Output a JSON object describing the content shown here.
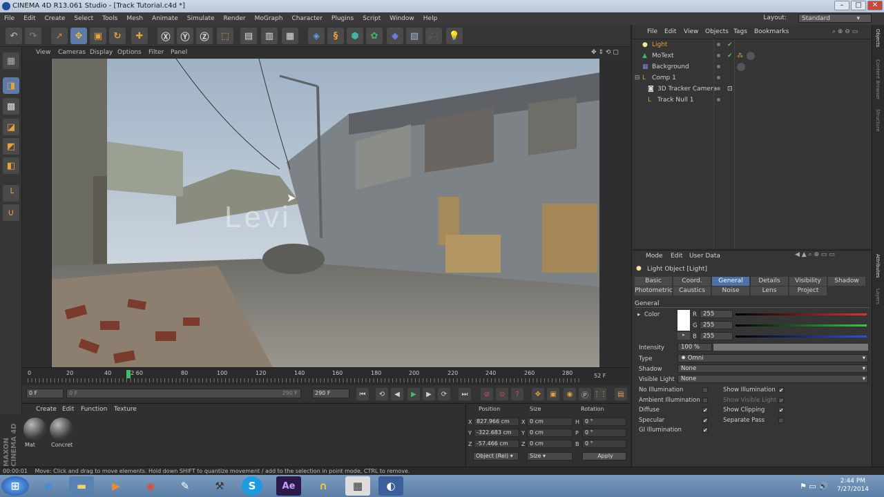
{
  "window": {
    "title": "CINEMA 4D R13.061 Studio - [Track Tutorial.c4d *]"
  },
  "menubar": {
    "items": [
      "File",
      "Edit",
      "Create",
      "Select",
      "Tools",
      "Mesh",
      "Animate",
      "Simulate",
      "Render",
      "MoGraph",
      "Character",
      "Plugins",
      "Script",
      "Window",
      "Help"
    ],
    "layout_label": "Layout:",
    "layout_value": "Standard"
  },
  "viewport": {
    "menu": [
      "View",
      "Cameras",
      "Display",
      "Options",
      "Filter",
      "Panel"
    ],
    "overlay_text": "Levi"
  },
  "timeline": {
    "ticks": [
      "0",
      "20",
      "40",
      "52 60",
      "80",
      "100",
      "120",
      "140",
      "160",
      "180",
      "200",
      "220",
      "240",
      "260",
      "280"
    ],
    "end_label": "52 F",
    "current_frame": 52,
    "max_frame": 290
  },
  "animbar": {
    "start": "0 F",
    "slider_start": "0 F",
    "slider_end": "290 F",
    "end": "290 F"
  },
  "materials": {
    "menu": [
      "Create",
      "Edit",
      "Function",
      "Texture"
    ],
    "items": [
      "Mat",
      "Concret"
    ]
  },
  "coords": {
    "headers": [
      "Position",
      "Size",
      "Rotation"
    ],
    "rows": [
      {
        "axis": "X",
        "pos": "827.966 cm",
        "sizeaxis": "X",
        "size": "0 cm",
        "rotaxis": "H",
        "rot": "0 °"
      },
      {
        "axis": "Y",
        "pos": "-322.683 cm",
        "sizeaxis": "Y",
        "size": "0 cm",
        "rotaxis": "P",
        "rot": "0 °"
      },
      {
        "axis": "Z",
        "pos": "-57.466 cm",
        "sizeaxis": "Z",
        "size": "0 cm",
        "rotaxis": "B",
        "rot": "0 °"
      }
    ],
    "mode": "Object (Rel)",
    "size_mode": "Size",
    "apply": "Apply"
  },
  "objmgr": {
    "menu": [
      "File",
      "Edit",
      "View",
      "Objects",
      "Tags",
      "Bookmarks"
    ],
    "objects": [
      "Light",
      "MoText",
      "Background",
      "Comp 1",
      "3D Tracker Camera",
      "Track Null 1"
    ]
  },
  "attrmgr": {
    "menu": [
      "Mode",
      "Edit",
      "User Data"
    ],
    "title": "Light Object [Light]",
    "tabs_row1": [
      "Basic",
      "Coord.",
      "General",
      "Details",
      "Visibility",
      "Shadow"
    ],
    "tabs_row2": [
      "Photometric",
      "Caustics",
      "Noise",
      "Lens",
      "Project"
    ],
    "section": "General",
    "color_label": "Color",
    "rgb": [
      {
        "k": "R",
        "v": "255"
      },
      {
        "k": "G",
        "v": "255"
      },
      {
        "k": "B",
        "v": "255"
      }
    ],
    "intensity_label": "Intensity",
    "intensity": "100 %",
    "type_label": "Type",
    "type": "Omni",
    "shadow_label": "Shadow",
    "shadow": "None",
    "vislight_label": "Visible Light",
    "vislight": "None",
    "checks_left": [
      "No Illumination",
      "Ambient Illumination",
      "Diffuse",
      "Specular",
      "GI Illumination"
    ],
    "checks_right": [
      "Show Illumination",
      "Show Visible Light",
      "Show Clipping",
      "Separate Pass"
    ]
  },
  "sidestrip": [
    "Objects",
    "Content Browser",
    "Structure",
    "Attributes",
    "Layers"
  ],
  "statusbar": {
    "time": "00:00:01",
    "message": "Move: Click and drag to move elements. Hold down SHIFT to quantize movement / add to the selection in point mode, CTRL to remove."
  },
  "taskbar": {
    "time": "2:44 PM",
    "date": "7/27/2014"
  },
  "colors": {
    "accent": "#4b73a8",
    "selected_object": "#e8a13a",
    "playhead": "#3ec06a"
  }
}
